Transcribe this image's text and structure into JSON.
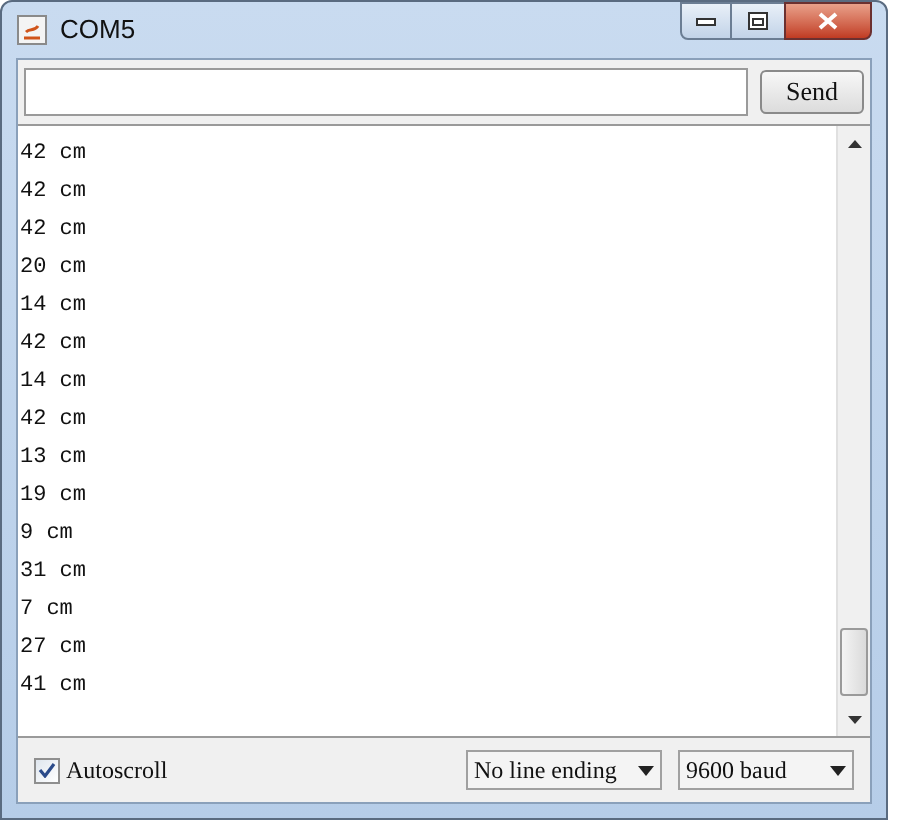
{
  "window": {
    "title": "COM5"
  },
  "send_button": "Send",
  "output_lines": [
    "42 cm",
    "42 cm",
    "42 cm",
    "20 cm",
    "14 cm",
    "42 cm",
    "14 cm",
    "42 cm",
    "13 cm",
    "19 cm",
    "9 cm",
    "31 cm",
    "7 cm",
    "27 cm",
    "41 cm"
  ],
  "autoscroll": {
    "label": "Autoscroll",
    "checked": true
  },
  "dropdowns": [
    {
      "value": "No line ending"
    },
    {
      "value": "9600 baud"
    }
  ]
}
